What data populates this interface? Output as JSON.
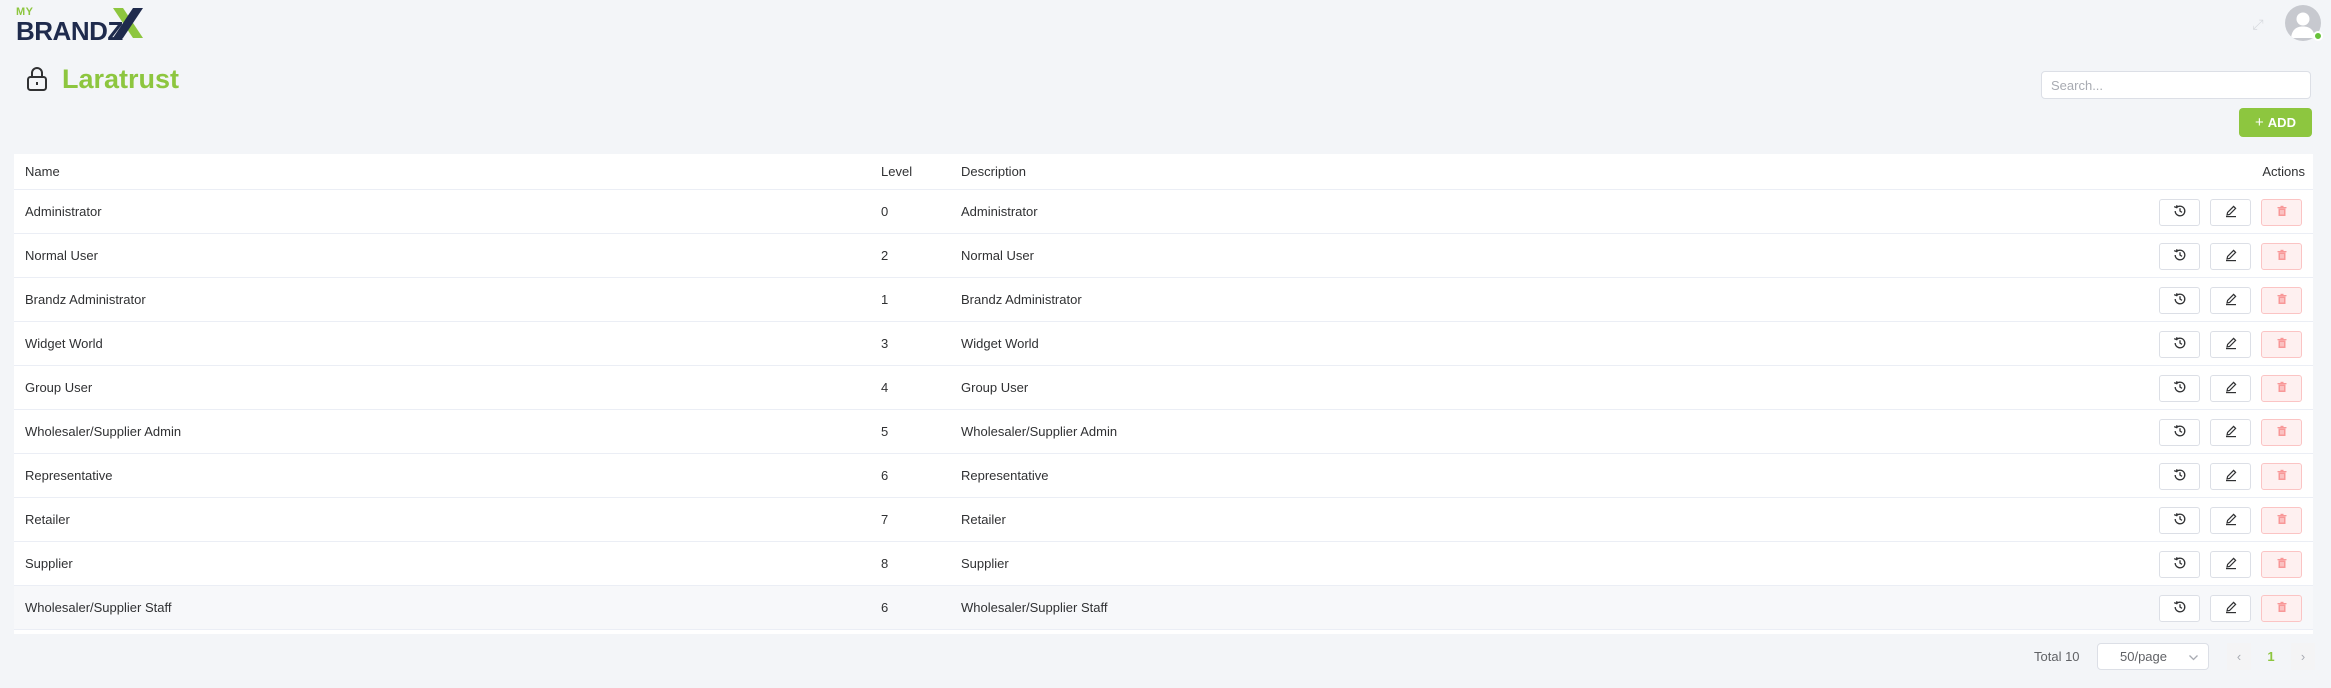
{
  "header": {
    "logo_prefix": "MY",
    "logo_text": "BRANDZ",
    "logo_mark": "X",
    "avatar_icon": "user-avatar-icon",
    "status_color": "#67c23a"
  },
  "page": {
    "title": "Laratrust",
    "title_icon": "lock-icon",
    "accent_color": "#8dc63f"
  },
  "search": {
    "placeholder": "Search...",
    "value": ""
  },
  "add_button": {
    "label": "ADD",
    "icon": "plus-icon"
  },
  "table": {
    "columns": {
      "name": "Name",
      "level": "Level",
      "description": "Description",
      "actions": "Actions"
    },
    "rows": [
      {
        "name": "Administrator",
        "level": "0",
        "description": "Administrator"
      },
      {
        "name": "Normal User",
        "level": "2",
        "description": "Normal User"
      },
      {
        "name": "Brandz Administrator",
        "level": "1",
        "description": "Brandz Administrator"
      },
      {
        "name": "Widget World",
        "level": "3",
        "description": "Widget World"
      },
      {
        "name": "Group User",
        "level": "4",
        "description": "Group User"
      },
      {
        "name": "Wholesaler/Supplier Admin",
        "level": "5",
        "description": "Wholesaler/Supplier Admin"
      },
      {
        "name": "Representative",
        "level": "6",
        "description": "Representative"
      },
      {
        "name": "Retailer",
        "level": "7",
        "description": "Retailer"
      },
      {
        "name": "Supplier",
        "level": "8",
        "description": "Supplier"
      },
      {
        "name": "Wholesaler/Supplier Staff",
        "level": "6",
        "description": "Wholesaler/Supplier Staff"
      }
    ],
    "row_actions": [
      "history-icon",
      "edit-icon",
      "delete-icon"
    ]
  },
  "pagination": {
    "total_label": "Total 10",
    "page_size": "50/page",
    "current_page": "1",
    "prev_icon": "chevron-left-icon",
    "next_icon": "chevron-right-icon"
  }
}
